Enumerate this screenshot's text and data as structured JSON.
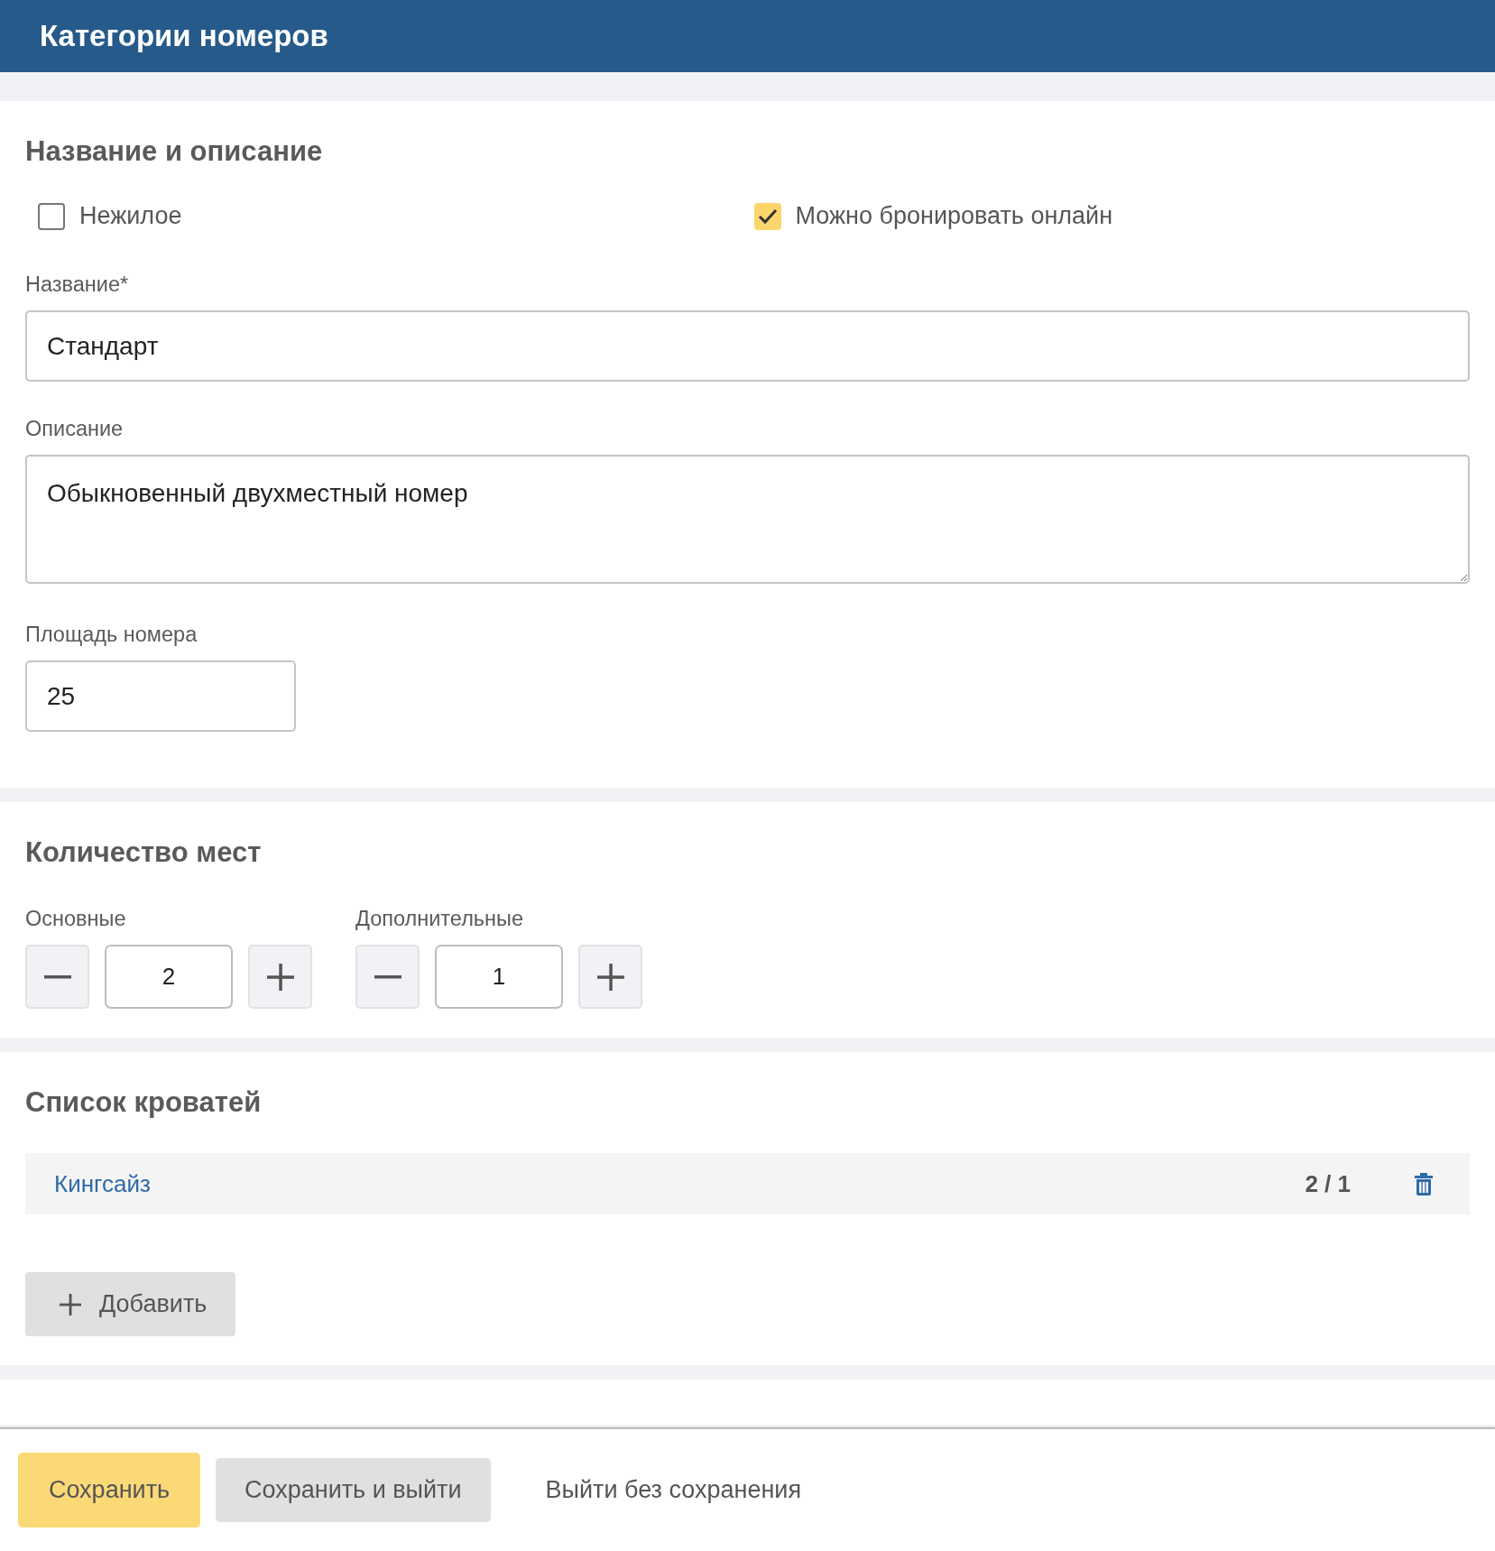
{
  "header": {
    "title": "Категории номеров"
  },
  "sections": [
    {
      "kind": "details",
      "title": "Название и описание",
      "checkboxes": [
        {
          "label": "Нежилое",
          "checked": false
        },
        {
          "label": "Можно бронировать онлайн",
          "checked": true
        }
      ],
      "fields": [
        {
          "kind": "input",
          "label": "Название*",
          "value": "Стандарт"
        },
        {
          "kind": "textarea",
          "label": "Описание",
          "value": "Обыкновенный двухместный номер"
        },
        {
          "kind": "short",
          "label": "Площадь номера",
          "value": "25"
        }
      ]
    },
    {
      "kind": "places",
      "title": "Количество мест",
      "steppers": [
        {
          "label": "Основные",
          "value": "2"
        },
        {
          "label": "Дополнительные",
          "value": "1"
        }
      ]
    },
    {
      "kind": "beds",
      "title": "Список кроватей",
      "beds": [
        {
          "name": "Кингсайз",
          "places": "2 / 1"
        }
      ],
      "add_button": "Добавить"
    }
  ],
  "footer": {
    "buttons": [
      {
        "kind": "primary",
        "label": "Сохранить"
      },
      {
        "kind": "secondary",
        "label": "Сохранить и выйти"
      },
      {
        "kind": "link",
        "label": "Выйти без сохранения"
      }
    ]
  }
}
